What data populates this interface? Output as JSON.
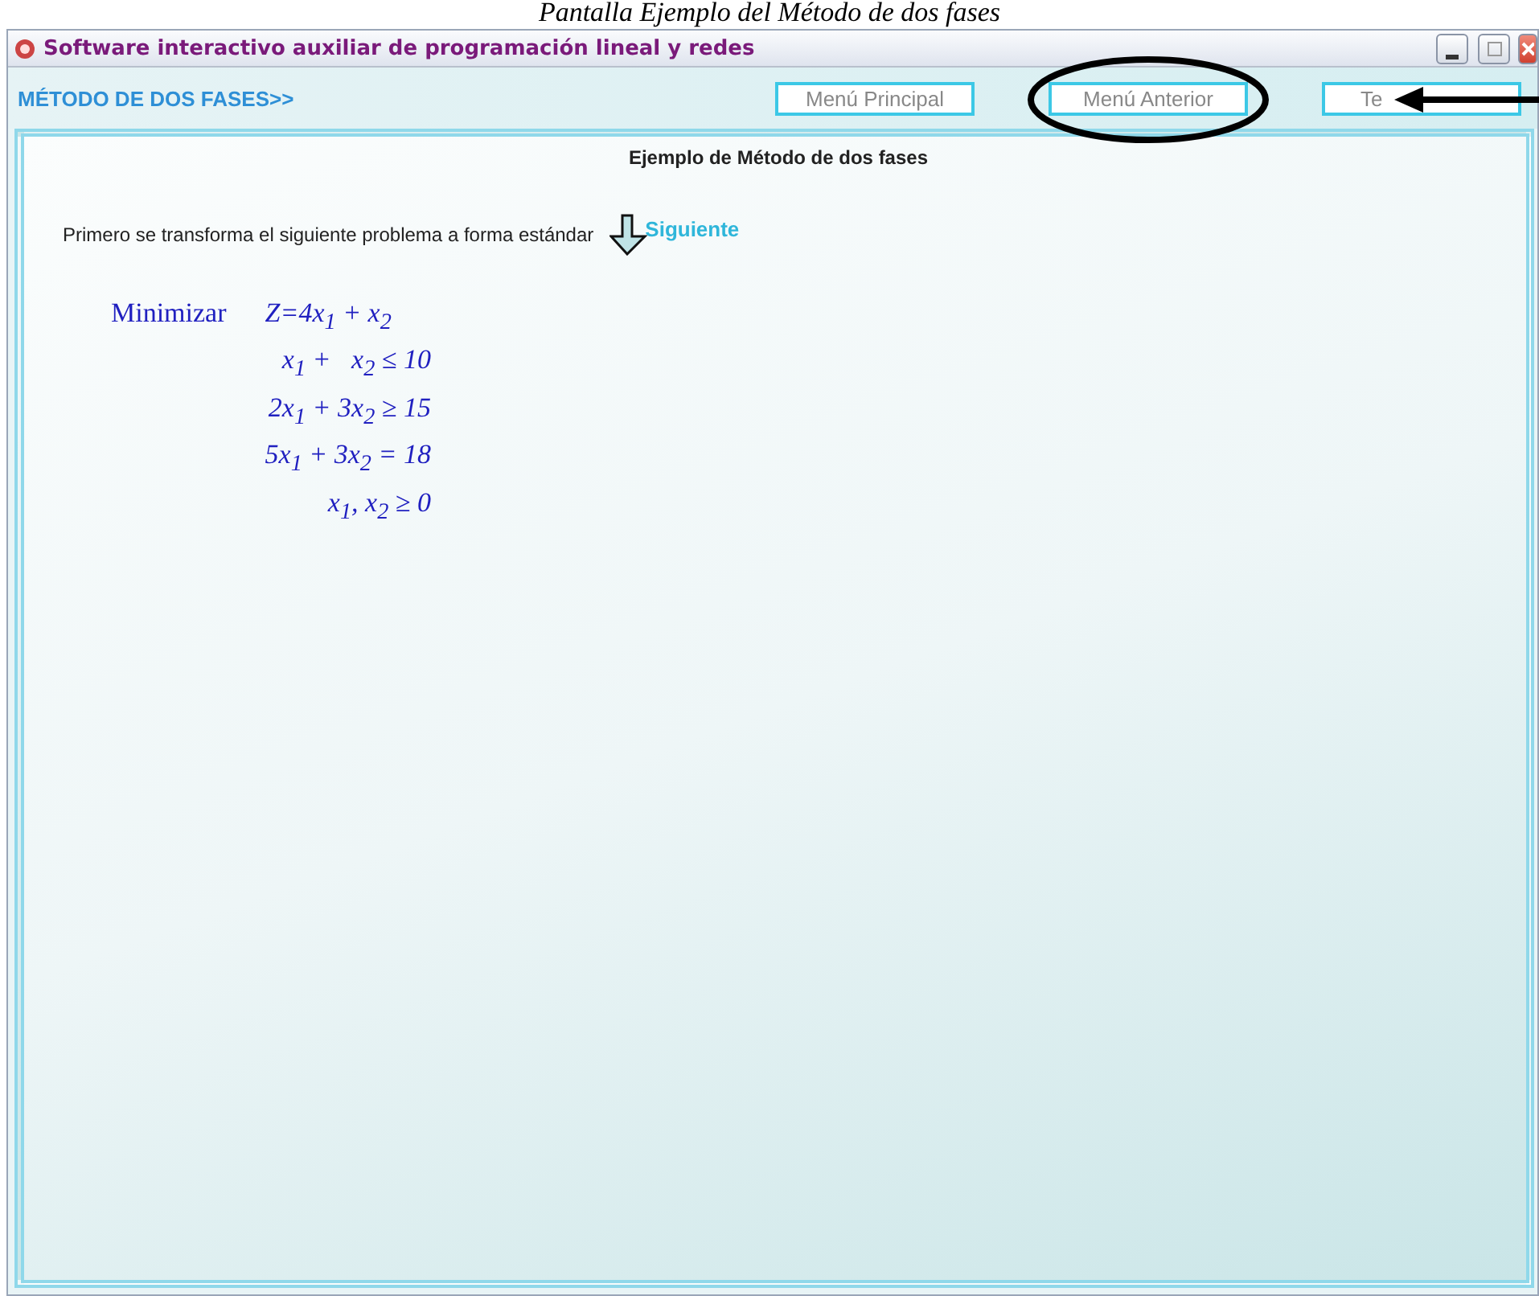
{
  "caption": "Pantalla Ejemplo del Método de dos fases",
  "window": {
    "title": "Software interactivo auxiliar de programación lineal y redes"
  },
  "toolbar": {
    "section": "MÉTODO DE DOS FASES>>",
    "buttons": [
      {
        "label": "Menú Principal",
        "circled": false
      },
      {
        "label": "Menú Anterior",
        "circled": true
      },
      {
        "label": "Te",
        "circled": false
      }
    ]
  },
  "content": {
    "heading": "Ejemplo de Método de dos fases",
    "intro": "Primero se transforma el siguiente problema a forma estándar",
    "next_link": "Siguiente",
    "problem": {
      "objective_label": "Minimizar",
      "objective": "Z=4x$_{1}$ + x$_{2}$",
      "constraints": [
        "x$_{1}$ +   x$_{2}$ ≤ 10",
        "2x$_{1}$ + 3x$_{2}$ ≥ 15",
        "5x$_{1}$ + 3x$_{2}$ = 18",
        "x$_{1}$, x$_{2}$ ≥ 0"
      ]
    }
  }
}
